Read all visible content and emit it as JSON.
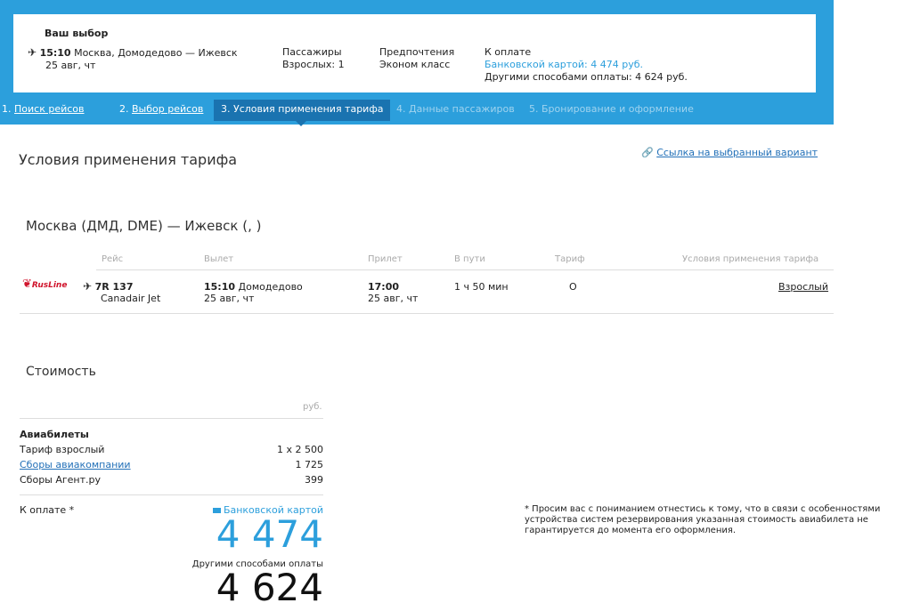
{
  "summary": {
    "title": "Ваш выбор",
    "time": "15:10",
    "route": "Москва, Домодедово — Ижевск",
    "date": "25 авг, чт",
    "passengers_label": "Пассажиры",
    "passengers_value": "Взрослых: 1",
    "prefs_label": "Предпочтения",
    "prefs_value": "Эконом класс",
    "pay_label": "К оплате",
    "pay_card": "Банковской картой: 4 474 руб.",
    "pay_other": "Другими способами оплаты: 4 624 руб."
  },
  "steps": [
    {
      "num": "1.",
      "label": "Поиск рейсов"
    },
    {
      "num": "2.",
      "label": "Выбор рейсов"
    },
    {
      "num": "",
      "label": "3. Условия применения тарифа"
    },
    {
      "num": "",
      "label": "4. Данные пассажиров"
    },
    {
      "num": "",
      "label": "5. Бронирование и оформление"
    }
  ],
  "page_title": "Условия применения тарифа",
  "link_selected": "Ссылка на выбранный вариант",
  "route_title": "Москва (ДМД, DME) — Ижевск (, )",
  "table": {
    "headers": [
      "Рейс",
      "Вылет",
      "Прилет",
      "В пути",
      "Тариф",
      "Условия применения тарифа"
    ],
    "airline_logo": "RusLine",
    "flight": "7R 137",
    "aircraft": "Canadair Jet",
    "dep_time": "15:10",
    "dep_airport": "Домодедово",
    "dep_date": "25 авг, чт",
    "arr_time": "17:00",
    "arr_date": "25 авг, чт",
    "duration": "1 ч 50 мин",
    "fare": "O",
    "conditions": "Взрослый"
  },
  "cost": {
    "title": "Стоимость",
    "currency": "руб.",
    "section": "Авиабилеты",
    "rows": [
      {
        "label": "Тариф взрослый",
        "value": "1 x 2 500"
      },
      {
        "label": "Сборы авиакомпании",
        "value": "1 725"
      },
      {
        "label": "Сборы Агент.ру",
        "value": "399"
      }
    ],
    "to_pay": "К оплате *",
    "card_label": "Банковской картой",
    "card_total": "4 474",
    "other_label": "Другими способами оплаты",
    "other_total": "4 624"
  },
  "note": "* Просим вас с пониманием отнестись к тому, что в связи с особенностями устройства систем резервирования указанная стоимость авиабилета не гарантируется до момента его оформления.",
  "colors": {
    "accent": "#2c9fdc",
    "active_step": "#1a73b0",
    "link": "#2270b8",
    "price": "#2c9fdc"
  }
}
